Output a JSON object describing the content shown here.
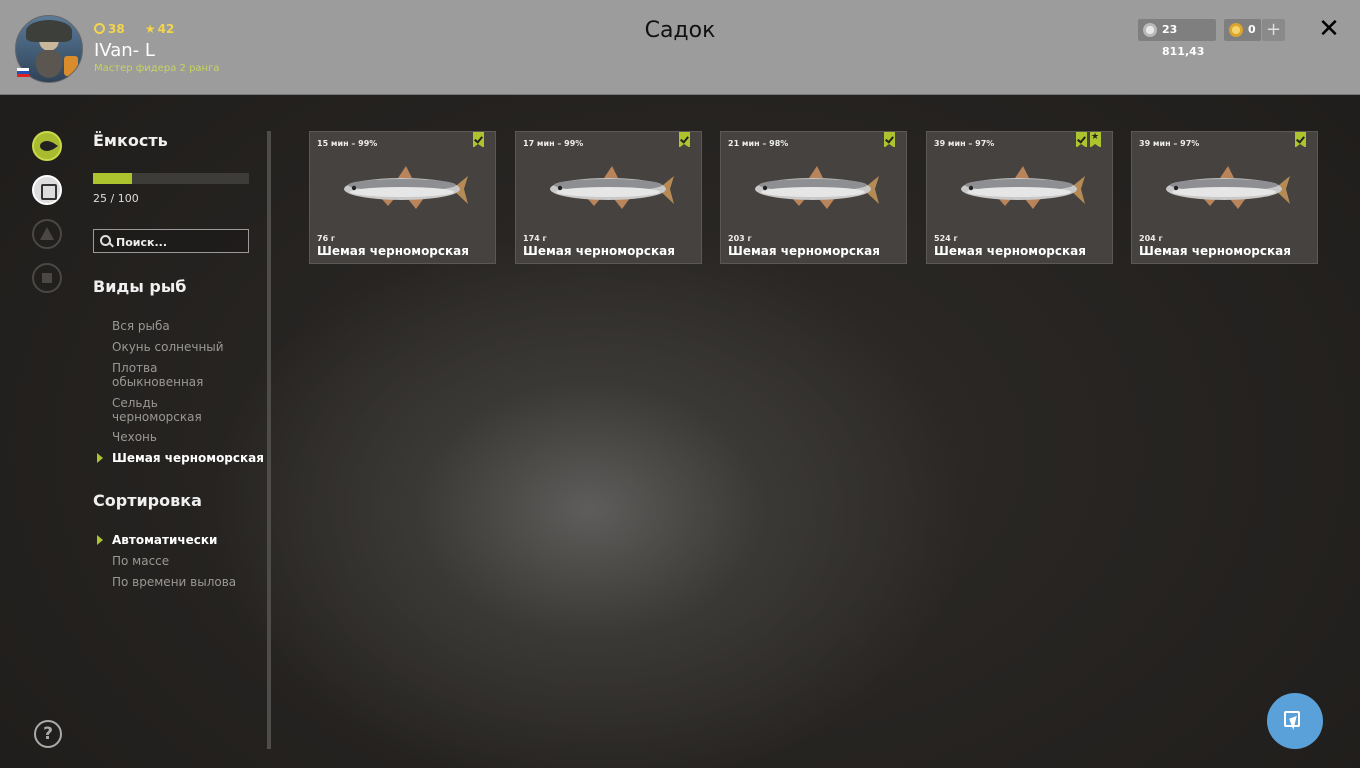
{
  "header": {
    "title": "Садок",
    "user": {
      "name": "IVan- L",
      "level": "38",
      "stars": "42",
      "rank": "Мастер фидера 2 ранга"
    },
    "currency": {
      "silver": "23 811,43",
      "gold": "0",
      "add_label": "+"
    },
    "close_label": "✕"
  },
  "sidebar": {
    "capacity_title": "Ёмкость",
    "capacity_used": 25,
    "capacity_max": 100,
    "capacity_text": "25 / 100",
    "search_placeholder": "Поиск...",
    "species_title": "Виды рыб",
    "species": [
      "Вся рыба",
      "Окунь солнечный",
      "Плотва обыкновенная",
      "Сельдь черноморская",
      "Чехонь",
      "Шемая черноморская"
    ],
    "selected_species": "Шемая черноморская",
    "sort_title": "Сортировка",
    "sort_options": [
      "Автоматически",
      "По массе",
      "По времени вылова"
    ],
    "selected_sort": "Автоматически",
    "help_label": "?"
  },
  "fish": [
    {
      "time_quality": "15 мин – 99%",
      "weight": "76 г",
      "name": "Шемая черноморская",
      "trophy": false
    },
    {
      "time_quality": "17 мин – 99%",
      "weight": "174 г",
      "name": "Шемая черноморская",
      "trophy": false
    },
    {
      "time_quality": "21 мин – 98%",
      "weight": "203 г",
      "name": "Шемая черноморская",
      "trophy": false
    },
    {
      "time_quality": "39 мин – 97%",
      "weight": "524 г",
      "name": "Шемая черноморская",
      "trophy": true
    },
    {
      "time_quality": "39 мин – 97%",
      "weight": "204 г",
      "name": "Шемая черноморская",
      "trophy": false
    }
  ],
  "colors": {
    "accent": "#aec42f",
    "header_bg": "#9c9c9c",
    "fab": "#5aa1d9"
  },
  "icons": {
    "fish_tab": "fish-icon",
    "keepnet_tab": "keepnet-icon",
    "camp_tab": "tent-icon",
    "home_tab": "home-icon"
  }
}
